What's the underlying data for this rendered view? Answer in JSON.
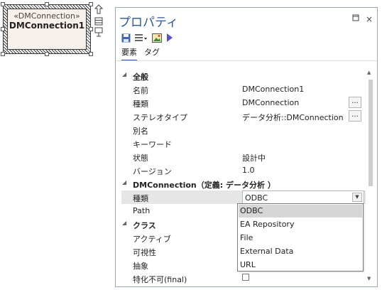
{
  "element": {
    "stereotype": "«DMConnection»",
    "name": "DMConnection1"
  },
  "panel": {
    "title": "プロパティ",
    "pin_icon": "pin-icon",
    "close_label": "×",
    "tabs": [
      "要素",
      "タグ"
    ],
    "active_tab": "要素"
  },
  "sections": {
    "general": "全般",
    "dm": "DMConnection（定義: データ分析 ）",
    "class": "クラス"
  },
  "rows": {
    "name": {
      "label": "名前",
      "value": "DMConnection1"
    },
    "kind": {
      "label": "種類",
      "value": "DMConnection"
    },
    "stereotype": {
      "label": "ステレオタイプ",
      "value": "データ分析::DMConnection"
    },
    "alias": {
      "label": "別名",
      "value": ""
    },
    "keyword": {
      "label": "キーワード",
      "value": ""
    },
    "status": {
      "label": "状態",
      "value": "設計中"
    },
    "version": {
      "label": "バージョン",
      "value": "1.0"
    },
    "dm_kind": {
      "label": "種類",
      "value": "ODBC"
    },
    "path": {
      "label": "Path",
      "value": ""
    },
    "active": {
      "label": "アクティブ"
    },
    "visibility": {
      "label": "可視性"
    },
    "abstract": {
      "label": "抽象"
    },
    "final": {
      "label": "特化不可(final)"
    }
  },
  "ellipsis": "...",
  "dropdown_options": [
    "ODBC",
    "EA Repository",
    "File",
    "External Data",
    "URL"
  ],
  "colors": {
    "accent": "#2b5797",
    "selection": "#e6e6e6",
    "highlight": "#d6d6d6"
  }
}
